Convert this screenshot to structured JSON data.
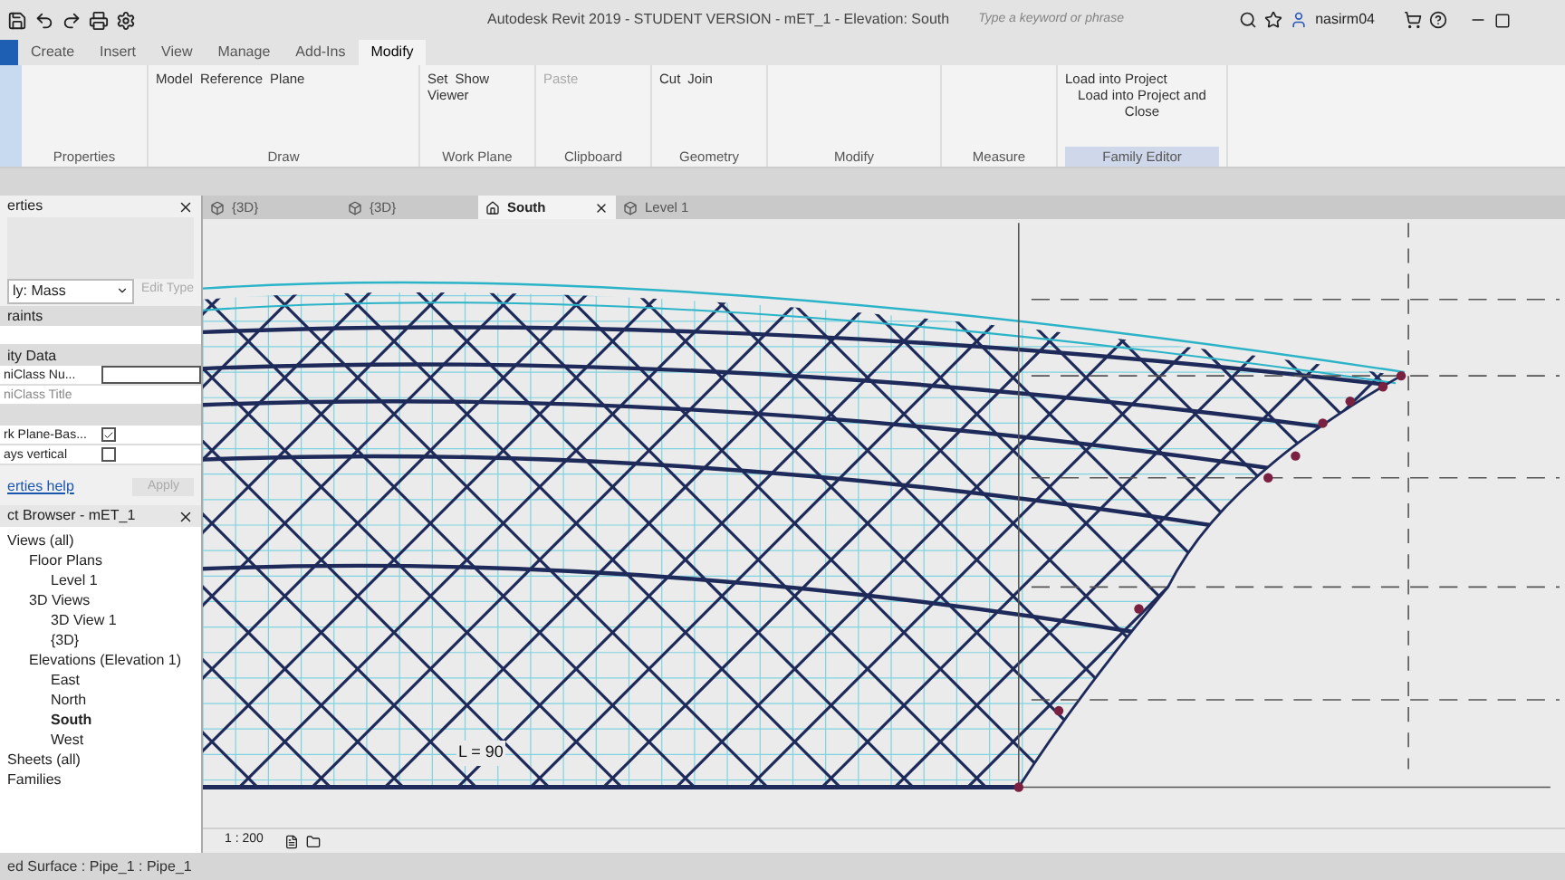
{
  "window": {
    "title": "Autodesk Revit 2019 - STUDENT VERSION - mET_1 - Elevation: South",
    "search": {
      "placeholder": "Type a keyword or phrase"
    },
    "user": "nasirm04"
  },
  "ribbon_tabs": [
    {
      "label": "Create",
      "selected": false
    },
    {
      "label": "Insert",
      "selected": false
    },
    {
      "label": "View",
      "selected": false
    },
    {
      "label": "Manage",
      "selected": false
    },
    {
      "label": "Add-Ins",
      "selected": false
    },
    {
      "label": "Modify",
      "selected": true
    }
  ],
  "ribbon_panels": [
    {
      "label": "Properties",
      "highlighted": false
    },
    {
      "label": "Draw",
      "highlighted": false,
      "items": [
        {
          "label": "Model",
          "disabled": false
        },
        {
          "label": "Reference",
          "disabled": false
        },
        {
          "label": "Plane",
          "disabled": false
        }
      ]
    },
    {
      "label": "Work Plane",
      "highlighted": false,
      "items": [
        {
          "label": "Set",
          "disabled": false
        },
        {
          "label": "Show",
          "disabled": false
        },
        {
          "label": "Viewer",
          "disabled": false
        }
      ]
    },
    {
      "label": "Clipboard",
      "highlighted": false,
      "items": [
        {
          "label": "Paste",
          "disabled": true
        }
      ]
    },
    {
      "label": "Geometry",
      "highlighted": false,
      "items": [
        {
          "label": "Cut",
          "disabled": false
        },
        {
          "label": "Join",
          "disabled": false
        }
      ]
    },
    {
      "label": "Modify",
      "highlighted": false
    },
    {
      "label": "Measure",
      "highlighted": false
    },
    {
      "label": "Family Editor",
      "highlighted": true,
      "items": [
        {
          "label": "Load into Project",
          "disabled": false
        },
        {
          "label": "Load into Project and Close",
          "disabled": false
        }
      ]
    }
  ],
  "properties": {
    "title": "erties",
    "type": "ly: Mass",
    "edit_type": "Edit Type",
    "rows": [
      {
        "kind": "section",
        "label": "raints"
      },
      {
        "kind": "text"
      },
      {
        "kind": "section",
        "label": "ity Data"
      },
      {
        "kind": "input",
        "label": "niClass Nu..."
      },
      {
        "kind": "text",
        "label": "niClass Title"
      },
      {
        "kind": "section"
      },
      {
        "kind": "checkbox",
        "label": "rk Plane-Bas...",
        "checked": true
      },
      {
        "kind": "checkbox",
        "label": "ays vertical",
        "checked": false
      }
    ],
    "help": "erties help",
    "apply": "Apply"
  },
  "project_browser": {
    "title": "ct Browser - mET_1",
    "tree": [
      {
        "label": "Views (all)",
        "bold": false,
        "children": [
          {
            "label": "Floor Plans",
            "bold": false,
            "children": [
              {
                "label": "Level 1",
                "bold": false
              }
            ]
          },
          {
            "label": "3D Views",
            "bold": false,
            "children": [
              {
                "label": "3D View 1",
                "bold": false
              },
              {
                "label": "{3D}",
                "bold": false
              }
            ]
          },
          {
            "label": "Elevations (Elevation 1)",
            "bold": false,
            "children": [
              {
                "label": "East",
                "bold": false
              },
              {
                "label": "North",
                "bold": false
              },
              {
                "label": "South",
                "bold": true
              },
              {
                "label": "West",
                "bold": false
              }
            ]
          }
        ]
      },
      {
        "label": "Sheets (all)",
        "bold": false
      },
      {
        "label": "Families",
        "bold": false
      }
    ]
  },
  "view_tabs": [
    {
      "label": "{3D}",
      "selected": false
    },
    {
      "label": "{3D}",
      "selected": false
    },
    {
      "label": "South",
      "selected": true
    },
    {
      "label": "Level 1",
      "selected": false
    }
  ],
  "canvas": {
    "dimension_label": "L = 90",
    "scale": "1 : 200"
  },
  "status_bar": "ed Surface : Pipe_1 : Pipe_1"
}
